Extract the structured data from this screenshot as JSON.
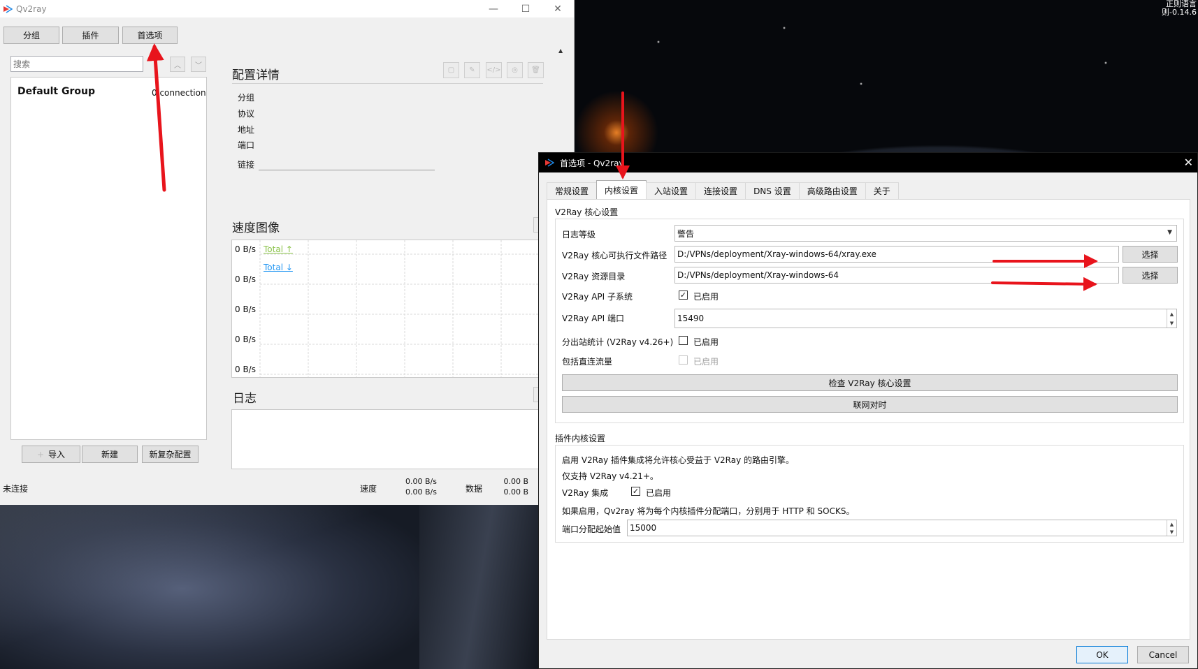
{
  "desktop": {
    "corner_text_lines": [
      "正则语言",
      "则-0.14.6"
    ]
  },
  "main_window": {
    "title": "Qv2ray",
    "controls": {
      "minimize": "—",
      "maximize": "☐",
      "close": "✕"
    },
    "toolbar": {
      "group_label": "分组",
      "plugins_label": "插件",
      "preferences_label": "首选项"
    },
    "search": {
      "placeholder": "搜索"
    },
    "groups": [
      {
        "name": "Default Group",
        "count": "0 connection"
      }
    ],
    "bottom_buttons": {
      "import": "导入",
      "new": "新建",
      "new_complex": "新复杂配置"
    },
    "details": {
      "title": "配置详情",
      "fields": {
        "group": "分组",
        "protocol": "协议",
        "address": "地址",
        "port": "端口",
        "link": "链接"
      }
    },
    "speed_chart": {
      "title": "速度图像",
      "y_ticks": [
        "0 B/s",
        "0 B/s",
        "0 B/s",
        "0 B/s",
        "0 B/s"
      ],
      "legend": [
        {
          "label": "Total ↑",
          "color": "#8bc34a"
        },
        {
          "label": "Total ↓",
          "color": "#2196f3"
        }
      ]
    },
    "log": {
      "title": "日志"
    },
    "status": {
      "connection": "未连接",
      "speed_label": "速度",
      "speed_up": "0.00 B/s",
      "speed_down": "0.00 B/s",
      "data_label": "数据",
      "data_up": "0.00 B",
      "data_down": "0.00 B"
    }
  },
  "preferences": {
    "title": "首选项 - Qv2ray",
    "close": "✕",
    "tabs": [
      "常规设置",
      "内核设置",
      "入站设置",
      "连接设置",
      "DNS 设置",
      "高级路由设置",
      "关于"
    ],
    "active_tab": "内核设置",
    "core_section": {
      "title": "V2Ray 核心设置",
      "log_level_label": "日志等级",
      "log_level_value": "警告",
      "exe_path_label": "V2Ray 核心可执行文件路径",
      "exe_path_value": "D:/VPNs/deployment/Xray-windows-64/xray.exe",
      "asset_dir_label": "V2Ray 资源目录",
      "asset_dir_value": "D:/VPNs/deployment/Xray-windows-64",
      "browse_label": "选择",
      "api_label": "V2Ray API 子系统",
      "api_enabled": true,
      "api_port_label": "V2Ray API 端口",
      "api_port_value": "15490",
      "outbound_stats_label": "分出站统计 (V2Ray v4.26+)",
      "outbound_stats_enabled": false,
      "direct_traffic_label": "包括直连流量",
      "direct_traffic_enabled": false,
      "enabled_text": "已启用",
      "check_button": "检查 V2Ray 核心设置",
      "sync_time_button": "联网对时"
    },
    "plugin_section": {
      "title": "插件内核设置",
      "desc1": "启用 V2Ray 插件集成将允许核心受益于 V2Ray 的路由引擎。",
      "desc2": "仅支持 V2Ray v4.21+。",
      "integration_label": "V2Ray 集成",
      "integration_enabled": true,
      "enabled_text": "已启用",
      "desc3": "如果启用，Qv2ray 将为每个内核插件分配端口，分别用于 HTTP 和 SOCKS。",
      "port_start_label": "端口分配起始值",
      "port_start_value": "15000"
    },
    "ok_label": "OK",
    "cancel_label": "Cancel"
  },
  "colors": {
    "annotation_arrow": "#e8141c",
    "ok_border": "#0078d7",
    "upload_series": "#8bc34a",
    "download_series": "#2196f3"
  }
}
